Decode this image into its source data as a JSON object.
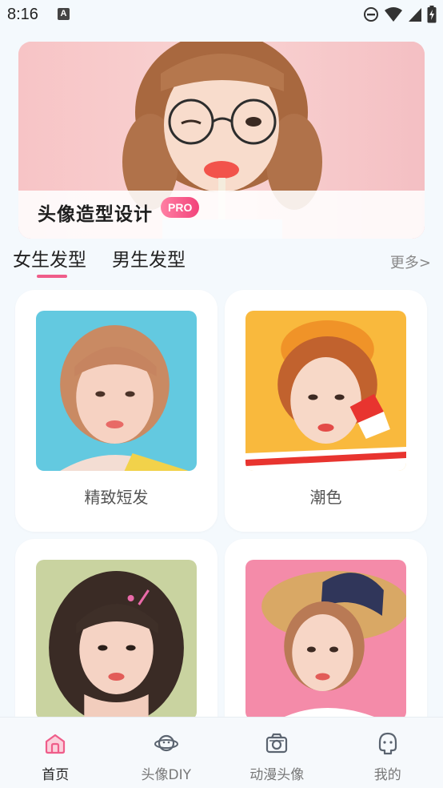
{
  "status_bar": {
    "time": "8:16",
    "notification_badge": "A"
  },
  "banner": {
    "title": "头像造型设计",
    "badge": "PRO"
  },
  "category_tabs": [
    {
      "label": "女生发型",
      "active": true
    },
    {
      "label": "男生发型",
      "active": false
    }
  ],
  "more_label": "更多>",
  "cards": [
    {
      "label": "精致短发",
      "bg": "#63c9e0"
    },
    {
      "label": "潮色",
      "bg": "#f9b93d"
    },
    {
      "label": "",
      "bg": "#c9d3a0"
    },
    {
      "label": "",
      "bg": "#f48ba9"
    }
  ],
  "bottom_nav": [
    {
      "label": "首页",
      "icon": "home-icon",
      "active": true
    },
    {
      "label": "头像DIY",
      "icon": "planet-face-icon",
      "active": false
    },
    {
      "label": "动漫头像",
      "icon": "camera-icon",
      "active": false
    },
    {
      "label": "我的",
      "icon": "profile-face-icon",
      "active": false
    }
  ],
  "colors": {
    "accent": "#ef5d8a",
    "background": "#f4f9fd"
  }
}
